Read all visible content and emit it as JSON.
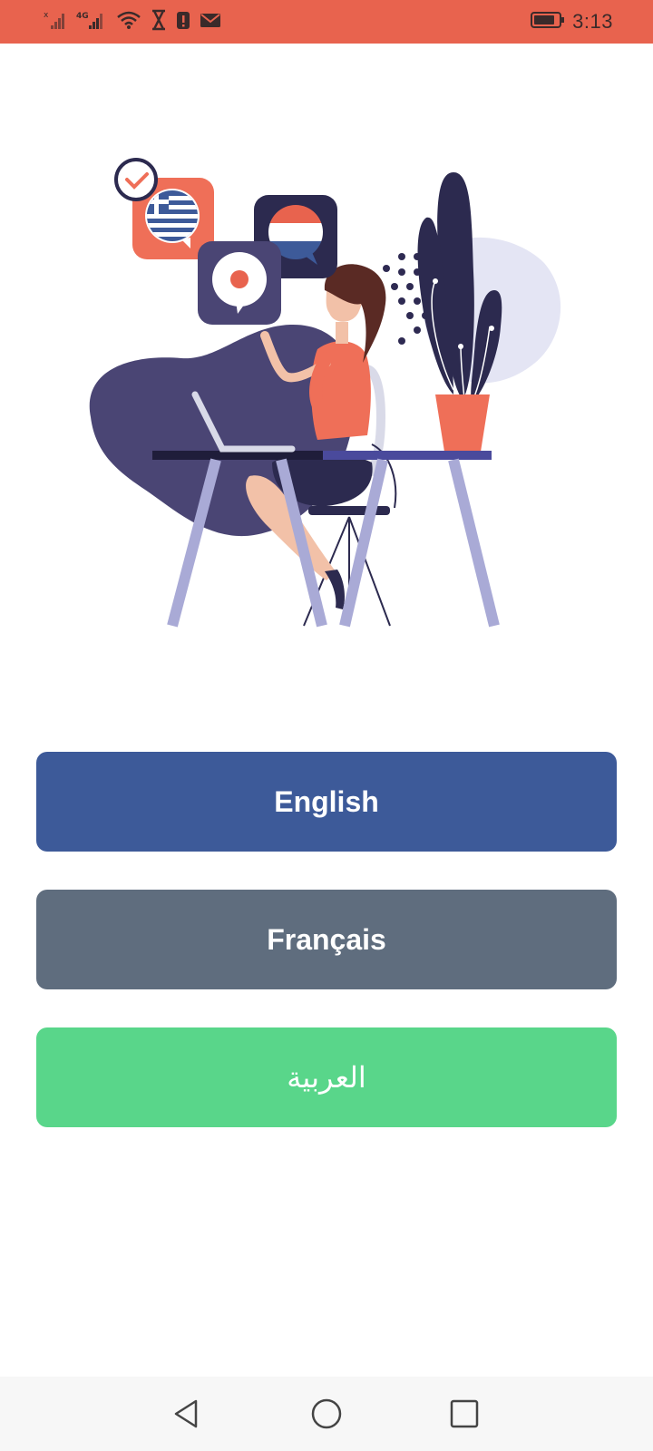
{
  "status_bar": {
    "background_color": "#e8634e",
    "time": "3:13",
    "network_label": "4G",
    "icons": [
      "signal-off-icon",
      "signal-4g-icon",
      "wifi-icon",
      "hourglass-icon",
      "alert-icon",
      "mail-icon",
      "battery-icon"
    ]
  },
  "illustration": {
    "icon": "language-learning-illustration"
  },
  "languages": {
    "english_label": "English",
    "french_label": "Français",
    "arabic_label": "العربية"
  },
  "colors": {
    "english_button": "#3d5a99",
    "french_button": "#5f6d7e",
    "arabic_button": "#59d68a"
  },
  "nav_bar": {
    "icons": [
      "back-icon",
      "home-icon",
      "recents-icon"
    ]
  }
}
